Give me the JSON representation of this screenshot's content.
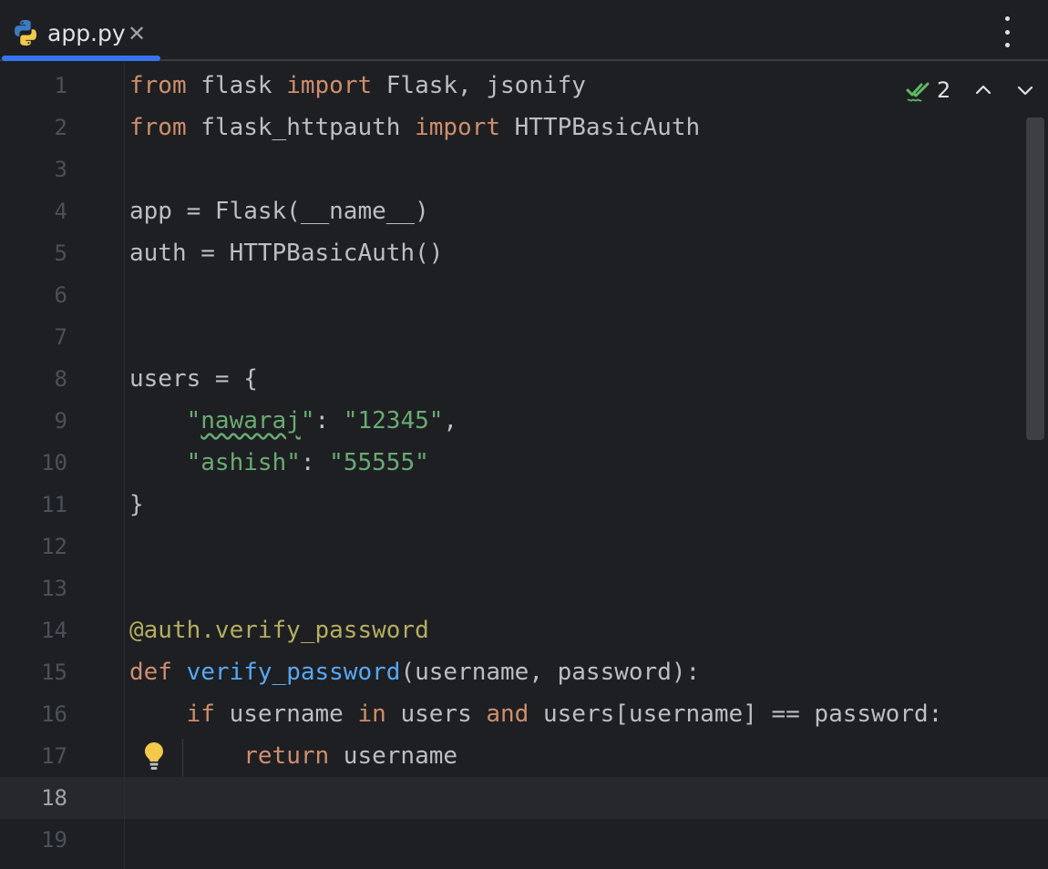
{
  "tab": {
    "file_name": "app.py",
    "close_glyph": "✕",
    "icon": "python-file-icon"
  },
  "menu": {
    "icon": "more-vertical-icon"
  },
  "inspection": {
    "icon": "double-check-icon",
    "count": "2",
    "prev_icon": "chevron-up-icon",
    "next_icon": "chevron-down-icon"
  },
  "editor": {
    "current_line": 18,
    "line_numbers": [
      "1",
      "2",
      "3",
      "4",
      "5",
      "6",
      "7",
      "8",
      "9",
      "10",
      "11",
      "12",
      "13",
      "14",
      "15",
      "16",
      "17",
      "18",
      "19"
    ],
    "lines": [
      [
        {
          "t": "kw",
          "v": "from"
        },
        {
          "t": "",
          "v": " flask "
        },
        {
          "t": "kw",
          "v": "import"
        },
        {
          "t": "",
          "v": " Flask, jsonify"
        }
      ],
      [
        {
          "t": "kw",
          "v": "from"
        },
        {
          "t": "",
          "v": " flask_httpauth "
        },
        {
          "t": "kw",
          "v": "import"
        },
        {
          "t": "",
          "v": " HTTPBasicAuth"
        }
      ],
      [],
      [
        {
          "t": "",
          "v": "app = Flask(__name__)"
        }
      ],
      [
        {
          "t": "",
          "v": "auth = HTTPBasicAuth()"
        }
      ],
      [],
      [],
      [
        {
          "t": "",
          "v": "users = {"
        }
      ],
      [
        {
          "t": "",
          "v": "    "
        },
        {
          "t": "str",
          "v": "\""
        },
        {
          "t": "str typo",
          "v": "nawaraj"
        },
        {
          "t": "str",
          "v": "\""
        },
        {
          "t": "",
          "v": ": "
        },
        {
          "t": "str",
          "v": "\"12345\""
        },
        {
          "t": "",
          "v": ","
        }
      ],
      [
        {
          "t": "",
          "v": "    "
        },
        {
          "t": "str",
          "v": "\"ashish\""
        },
        {
          "t": "",
          "v": ": "
        },
        {
          "t": "str",
          "v": "\"55555\""
        }
      ],
      [
        {
          "t": "",
          "v": "}"
        }
      ],
      [],
      [],
      [
        {
          "t": "dec",
          "v": "@auth.verify_password"
        }
      ],
      [
        {
          "t": "kw",
          "v": "def"
        },
        {
          "t": "",
          "v": " "
        },
        {
          "t": "fn",
          "v": "verify_password"
        },
        {
          "t": "",
          "v": "(username, password):"
        }
      ],
      [
        {
          "t": "",
          "v": "    "
        },
        {
          "t": "kw",
          "v": "if"
        },
        {
          "t": "",
          "v": " username "
        },
        {
          "t": "kw",
          "v": "in"
        },
        {
          "t": "",
          "v": " users "
        },
        {
          "t": "kw",
          "v": "and"
        },
        {
          "t": "",
          "v": " users[username] == password:"
        }
      ],
      [
        {
          "t": "",
          "v": "        "
        },
        {
          "t": "kw",
          "v": "return"
        },
        {
          "t": "",
          "v": " username"
        }
      ],
      [],
      []
    ]
  },
  "colors": {
    "background": "#1e1f22",
    "keyword": "#cf8e6d",
    "string": "#6aab73",
    "decorator": "#b3ae60",
    "function": "#56a8f5",
    "accent": "#3574f0"
  }
}
